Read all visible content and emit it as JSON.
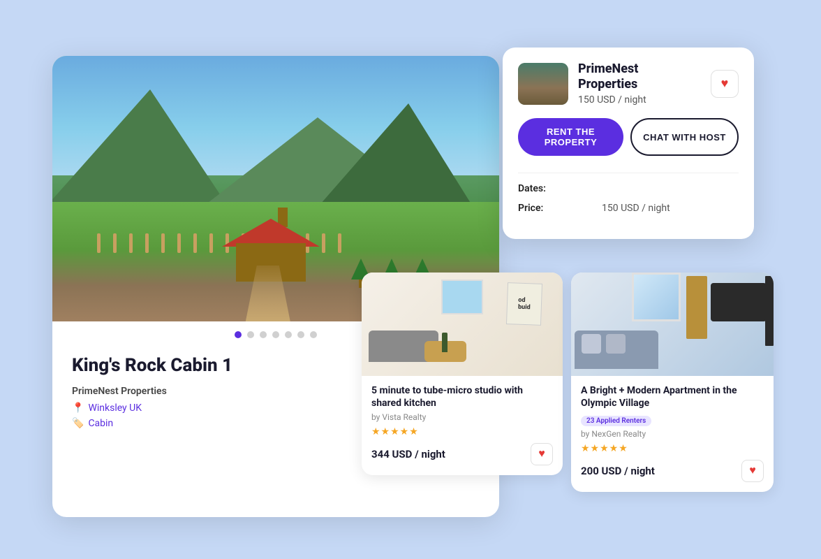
{
  "background": "#c5d8f5",
  "main_card": {
    "title": "King's Rock Cabin 1",
    "host": "PrimeNest Properties",
    "location": "Winksley UK",
    "category": "Cabin",
    "dots": [
      "active",
      "",
      "",
      "",
      "",
      "",
      ""
    ]
  },
  "booking_card": {
    "company": "PrimeNest Properties",
    "price_per_night": "150 USD / night",
    "rent_button": "RENT THE PROPERTY",
    "chat_button": "CHAT WITH HOST",
    "dates_label": "Dates:",
    "price_label": "Price:",
    "price_value": "150 USD / night"
  },
  "listing1": {
    "title": "5 minute to tube-micro studio with shared kitchen",
    "by": "by Vista Realty",
    "stars": "★★★★★",
    "price": "344 USD / night",
    "sign_text": "od buid"
  },
  "listing2": {
    "title": "A Bright + Modern Apartment in the Olympic Village",
    "by": "by NexGen Realty",
    "badge": "23 Applied Renters",
    "stars": "★★★★★",
    "price": "200 USD / night"
  }
}
